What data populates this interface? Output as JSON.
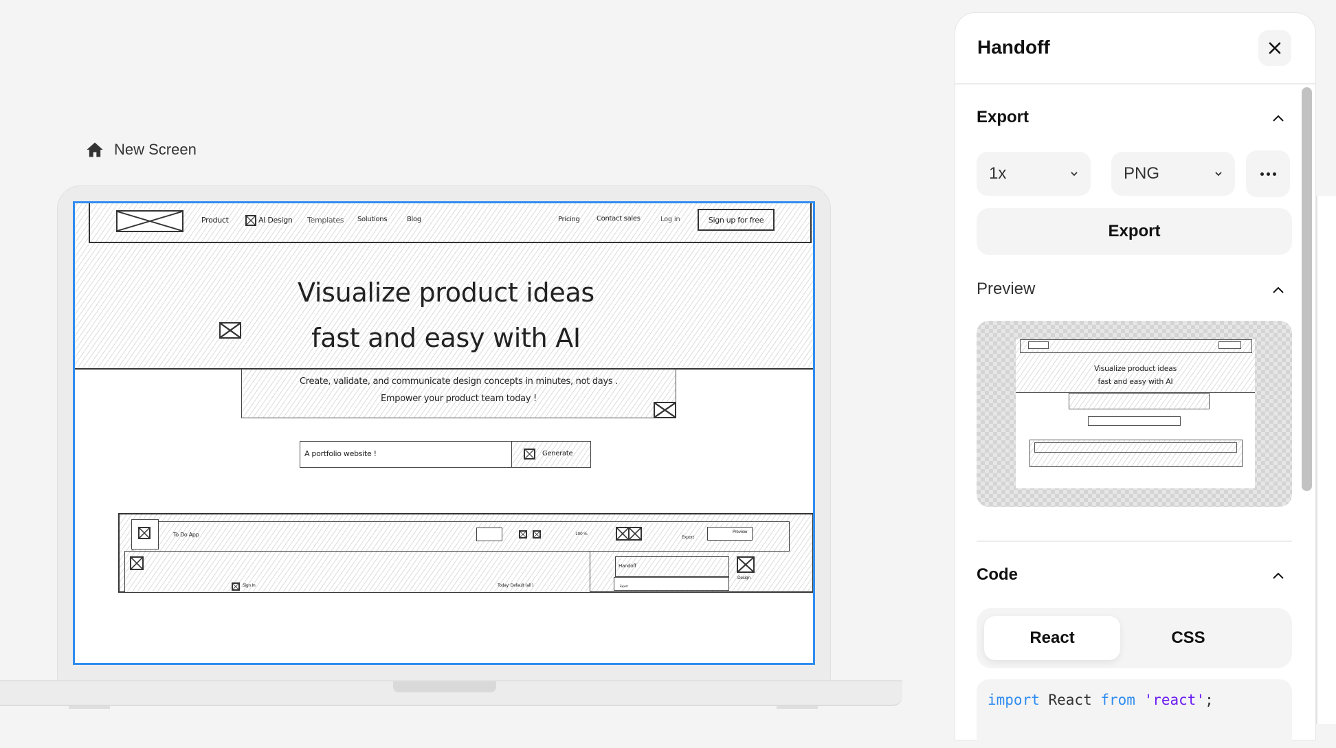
{
  "canvas": {
    "screen_label": "New Screen",
    "home_icon": "home-icon"
  },
  "wireframe": {
    "nav": {
      "items_left": [
        "Product",
        "AI Design",
        "Templates",
        "Solutions",
        "Blog"
      ],
      "items_right": [
        "Pricing",
        "Contact sales",
        "Log in"
      ],
      "cta": "Sign up for free"
    },
    "hero": {
      "title_line1": "Visualize product ideas",
      "title_line2": "fast and easy with AI",
      "subtitle_line1": "Create, validate, and communicate design concepts in minutes, not days .",
      "subtitle_line2": "Empower your product team today !"
    },
    "prompt": {
      "input_value": "A portfolio website !",
      "button_label": "Generate"
    },
    "app_mock": {
      "app_title": "To Do App",
      "zoom_label": "100 %",
      "export_label": "Export",
      "preview_label": "Preview",
      "handoff_label": "Handoff",
      "design_label": "Design",
      "sign_in_label": "Sign In",
      "status_label": "Today' Default (all )",
      "export_small": "Export"
    }
  },
  "panel": {
    "title": "Handoff",
    "close_icon": "close-icon",
    "export_section": {
      "title": "Export",
      "scale_value": "1x",
      "format_value": "PNG",
      "more_icon": "more-horizontal-icon",
      "export_button": "Export"
    },
    "preview_section": {
      "title": "Preview"
    },
    "code_section": {
      "title": "Code",
      "tabs": [
        "React",
        "CSS"
      ],
      "active_tab": "React",
      "code_line1": {
        "kw1": "import",
        "id": " React ",
        "kw2": "from",
        "str": " 'react'",
        "end": ";"
      }
    }
  },
  "colors": {
    "selection": "#2f8cf0",
    "code_keyword": "#2f8cf0",
    "code_string": "#6a1bf0"
  }
}
